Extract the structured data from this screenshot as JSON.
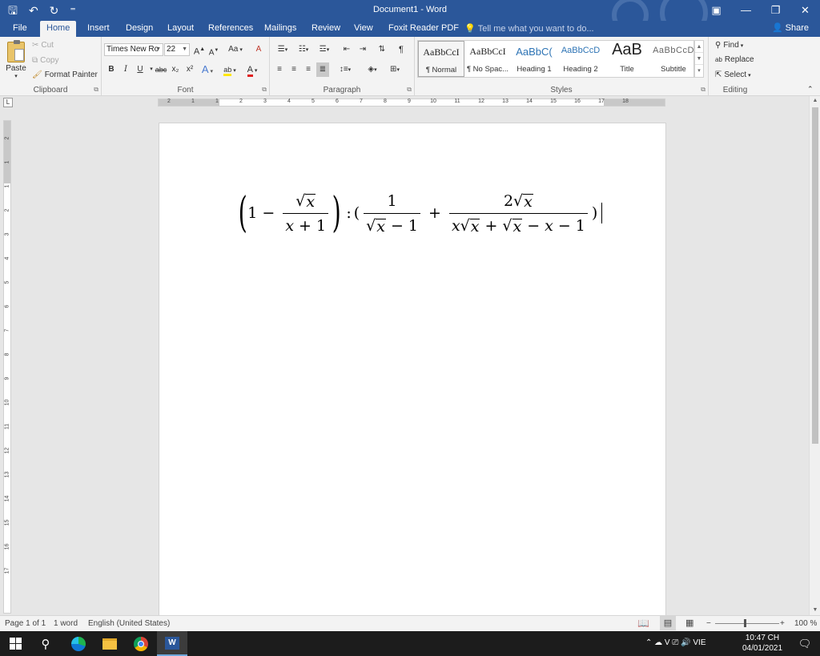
{
  "window": {
    "title": "Document1 - Word",
    "controls": [
      "▣",
      "—",
      "❐",
      "✕"
    ]
  },
  "qat": {
    "save": "🖫",
    "undo": "↶",
    "redo": "↻",
    "customize": "⁼"
  },
  "tabs": [
    {
      "label": "File"
    },
    {
      "label": "Home"
    },
    {
      "label": "Insert"
    },
    {
      "label": "Design"
    },
    {
      "label": "Layout"
    },
    {
      "label": "References"
    },
    {
      "label": "Mailings"
    },
    {
      "label": "Review"
    },
    {
      "label": "View"
    },
    {
      "label": "Foxit Reader PDF"
    }
  ],
  "tell_me": "Tell me what you want to do...",
  "share": "Share",
  "ribbon": {
    "clipboard": {
      "label": "Clipboard",
      "paste": "Paste",
      "cut": "Cut",
      "copy": "Copy",
      "format_painter": "Format Painter"
    },
    "font": {
      "label": "Font",
      "font_name": "Times New Ro",
      "font_size": "22",
      "grow": "A",
      "shrink": "A",
      "change_case": "Aa",
      "clear": "A",
      "bold": "B",
      "italic": "I",
      "underline": "U",
      "strike": "abc",
      "subscript": "x₂",
      "superscript": "x²",
      "effects": "A",
      "highlight": "ab",
      "font_color": "A"
    },
    "paragraph": {
      "label": "Paragraph",
      "show_marks": "¶"
    },
    "styles": {
      "label": "Styles",
      "items": [
        {
          "sample": "AaBbCcI",
          "name": "¶ Normal"
        },
        {
          "sample": "AaBbCcI",
          "name": "¶ No Spac..."
        },
        {
          "sample": "AaBbC(",
          "name": "Heading 1"
        },
        {
          "sample": "AaBbCcD",
          "name": "Heading 2"
        },
        {
          "sample": "AaB",
          "name": "Title"
        },
        {
          "sample": "AaBbCcD",
          "name": "Subtitle"
        }
      ]
    },
    "editing": {
      "label": "Editing",
      "find": "Find",
      "replace": "Replace",
      "select": "Select"
    }
  },
  "ruler": {
    "corner": "L",
    "labels": [
      "2",
      "1",
      "1",
      "2",
      "3",
      "4",
      "5",
      "6",
      "7",
      "8",
      "9",
      "10",
      "11",
      "12",
      "13",
      "14",
      "15",
      "16",
      "17",
      "18"
    ],
    "vlabels": [
      "2",
      "1",
      "1",
      "2",
      "3",
      "4",
      "5",
      "6",
      "7",
      "8",
      "9",
      "10",
      "11",
      "12",
      "13",
      "14",
      "15",
      "16",
      "17"
    ]
  },
  "equation": {
    "one": "1",
    "minus": "−",
    "x": "x",
    "plus": "+",
    "colon": ":",
    "two": "2",
    "lparen": "(",
    "rparen": ")"
  },
  "status": {
    "page": "Page 1 of 1",
    "words": "1 word",
    "language": "English (United States)",
    "zoom": "100 %",
    "zoom_minus": "−",
    "zoom_plus": "+"
  },
  "taskbar": {
    "search_icon": "⚲",
    "tray": "⌃  ☁  V  ⎚  🔊  VIE",
    "time": "10:47 CH",
    "date": "04/01/2021"
  }
}
